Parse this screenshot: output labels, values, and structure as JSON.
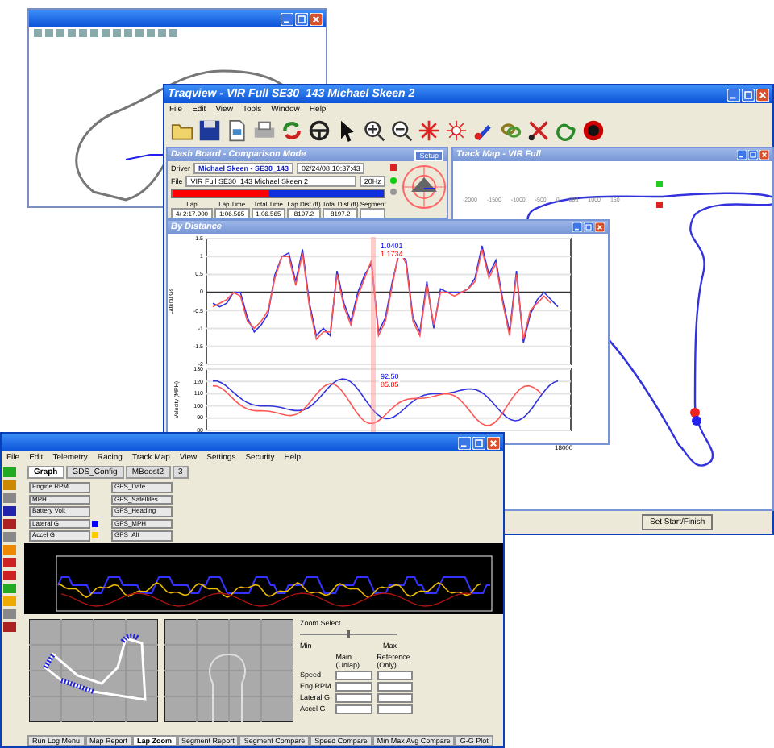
{
  "traqview": {
    "title": "Traqview - VIR Full SE30_143 Michael Skeen 2",
    "menu": [
      "File",
      "Edit",
      "View",
      "Tools",
      "Window",
      "Help"
    ],
    "dashboard": {
      "title": "Dash Board - Comparison Mode",
      "setup_button": "Setup",
      "driver_label": "Driver",
      "driver": "Michael Skeen - SE30_143",
      "timestamp": "02/24/08 10:37:43",
      "file_label": "File",
      "file": "VIR Full SE30_143 Michael Skeen 2",
      "rate": "20Hz",
      "speed_bar": {
        "level": 0.46
      },
      "columns": [
        "Lap",
        "Lap Time",
        "Total Time",
        "Lap Dist (ft)",
        "Total Dist (ft)",
        "Segment"
      ],
      "values": [
        "4/ 2:17.900",
        "1:06.565",
        "1:06.565",
        "8197.2",
        "8197.2"
      ]
    },
    "track_map": {
      "title": "Track Map - VIR Full",
      "x_ticks": [
        "-2000",
        "-1500",
        "-1000",
        "-500",
        "0",
        "500",
        "1000",
        "150"
      ],
      "button": "Set Start/Finish"
    },
    "by_distance": {
      "title": "By Distance",
      "lateral": {
        "cursor": [
          "1.0401",
          "1.1734"
        ],
        "chart_data": {
          "type": "line",
          "grid": true,
          "ylabel": "Lateral Gs",
          "ylim": [
            -2,
            1.5
          ],
          "yticks": [
            1.5,
            1,
            0.5,
            0,
            -0.5,
            -1,
            -1.5,
            -2
          ],
          "series": [
            {
              "color": "#3333dd",
              "values": [
                -0.3,
                -0.4,
                -0.3,
                0,
                0,
                -0.7,
                -1.1,
                -0.9,
                -0.6,
                0.5,
                1.0,
                1.1,
                0.3,
                1.2,
                -0.3,
                -1.2,
                -1.0,
                -1.2,
                0.6,
                -0.3,
                -0.8,
                0,
                0.5,
                0.8,
                -1.1,
                -0.7,
                0.3,
                1.1,
                0.9,
                -0.7,
                -1.1,
                0.3,
                -1.0,
                0.1,
                0,
                0,
                0,
                0.1,
                0.4,
                1.3,
                0.5,
                0.9,
                -0.2,
                -1.1,
                0.6,
                -1.4,
                -0.6,
                -0.2,
                0,
                -0.2,
                -0.4
              ]
            },
            {
              "color": "#ff5555",
              "values": [
                -0.4,
                -0.3,
                -0.2,
                0,
                -0.1,
                -0.8,
                -1.0,
                -0.8,
                -0.5,
                0.4,
                1.0,
                1.0,
                0.2,
                1.1,
                -0.4,
                -1.3,
                -1.1,
                -1.1,
                0.5,
                -0.4,
                -0.9,
                -0.1,
                0.4,
                0.9,
                -1.2,
                -0.8,
                0.2,
                1.2,
                0.8,
                -0.8,
                -1.2,
                0.2,
                -0.9,
                0,
                0,
                -0.1,
                0,
                0.1,
                0.3,
                1.2,
                0.4,
                0.8,
                -0.3,
                -1.2,
                0.5,
                -1.3,
                -0.5,
                -0.3,
                -0.1,
                -0.3,
                null
              ]
            }
          ]
        }
      },
      "velocity": {
        "cursor": [
          "92.50",
          "85.85"
        ],
        "ylabel": "Velocity (MPH)",
        "yticks": [
          "130",
          "120",
          "110",
          "100",
          "90",
          "80"
        ]
      },
      "x_tick": "18000"
    }
  },
  "data_window": {
    "menu": [
      "File",
      "Edit",
      "Telemetry",
      "Racing",
      "Track Map",
      "View",
      "Settings",
      "Security",
      "Help"
    ],
    "tabs": [
      {
        "label": "Graph",
        "selected": true
      },
      {
        "label": "GDS_Config",
        "selected": false
      },
      {
        "label": "MBoost2",
        "selected": false
      },
      {
        "label": "3",
        "selected": false
      }
    ],
    "channels": [
      {
        "name": "Engine RPM"
      },
      {
        "name": "MPH"
      },
      {
        "name": "Battery Volt"
      },
      {
        "name": "Lateral G",
        "color": "#0000ff"
      },
      {
        "name": "Accel G",
        "color": "#ffcc00"
      }
    ],
    "gps_channels": [
      "GPS_Date",
      "GPS_Satellites",
      "GPS_Heading",
      "GPS_MPH",
      "GPS_Alt"
    ],
    "panel": {
      "zoom_label": "Zoom Select",
      "zoom": {
        "level": 0.5
      },
      "min": "Min",
      "max": "Max",
      "columns": [
        "Main (Unlap)",
        "Reference (Only)"
      ],
      "rows": [
        "Speed",
        "Eng RPM",
        "Lateral G",
        "Accel G"
      ]
    },
    "bottom_tabs": [
      {
        "label": "Run Log Menu",
        "selected": false
      },
      {
        "label": "Map Report",
        "selected": false
      },
      {
        "label": "Lap Zoom",
        "selected": true
      },
      {
        "label": "Segment Report",
        "selected": false
      },
      {
        "label": "Segment Compare",
        "selected": false
      },
      {
        "label": "Speed Compare",
        "selected": false
      },
      {
        "label": "Min Max Avg Compare",
        "selected": false
      },
      {
        "label": "G-G Plot",
        "selected": false
      }
    ]
  }
}
